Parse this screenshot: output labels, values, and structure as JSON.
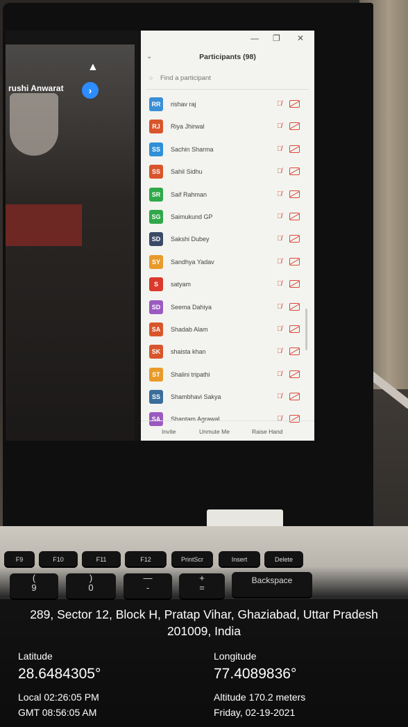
{
  "presenter_name": "rushi Anwarat",
  "panel": {
    "title": "Participants (98)",
    "search_placeholder": "Find a participant",
    "participants": [
      {
        "initials": "RR",
        "name": "rishav raj",
        "color": "#3a8fd6"
      },
      {
        "initials": "RJ",
        "name": "Riya Jhirwal",
        "color": "#d9552b"
      },
      {
        "initials": "SS",
        "name": "Sachin Sharma",
        "color": "#2f8fd8"
      },
      {
        "initials": "SS",
        "name": "Sahil Sidhu",
        "color": "#d9552b"
      },
      {
        "initials": "SR",
        "name": "Saif Rahman",
        "color": "#2fa84a"
      },
      {
        "initials": "SG",
        "name": "Saimukund GP",
        "color": "#2fa84a"
      },
      {
        "initials": "SD",
        "name": "Sakshi Dubey",
        "color": "#3a4a66"
      },
      {
        "initials": "SY",
        "name": "Sandhya Yadav",
        "color": "#e99a2a"
      },
      {
        "initials": "S",
        "name": "satyam",
        "color": "#d93a2b"
      },
      {
        "initials": "SD",
        "name": "Seema Dahiya",
        "color": "#9a5ac0"
      },
      {
        "initials": "SA",
        "name": "Shadab Alam",
        "color": "#d9552b"
      },
      {
        "initials": "SK",
        "name": "shaista khan",
        "color": "#d9552b"
      },
      {
        "initials": "ST",
        "name": "Shalini tripathi",
        "color": "#e99a2a"
      },
      {
        "initials": "SS",
        "name": "Shambhavi Sakya",
        "color": "#3a6e9a"
      },
      {
        "initials": "SA",
        "name": "Shantam Agrawal",
        "color": "#9a5ac0"
      }
    ],
    "footer": {
      "invite": "Invite",
      "unmute": "Unmute Me",
      "raise_hand": "Raise Hand"
    }
  },
  "keyboard": {
    "row1": [
      "F9",
      "F10",
      "F11",
      "F12",
      "PrintScr",
      "Insert",
      "Delete"
    ],
    "backspace": "Backspace",
    "row2": [
      "(\n9",
      ")\n0",
      "—\n-",
      "+\n="
    ]
  },
  "overlay": {
    "address": "289, Sector 12, Block H, Pratap Vihar, Ghaziabad, Uttar Pradesh 201009, India",
    "latitude_label": "Latitude",
    "latitude": "28.6484305°",
    "longitude_label": "Longitude",
    "longitude": "77.4089836°",
    "local_time": "Local 02:26:05 PM",
    "gmt_time": "GMT 08:56:05 AM",
    "altitude": "Altitude 170.2 meters",
    "date": "Friday, 02-19-2021"
  }
}
